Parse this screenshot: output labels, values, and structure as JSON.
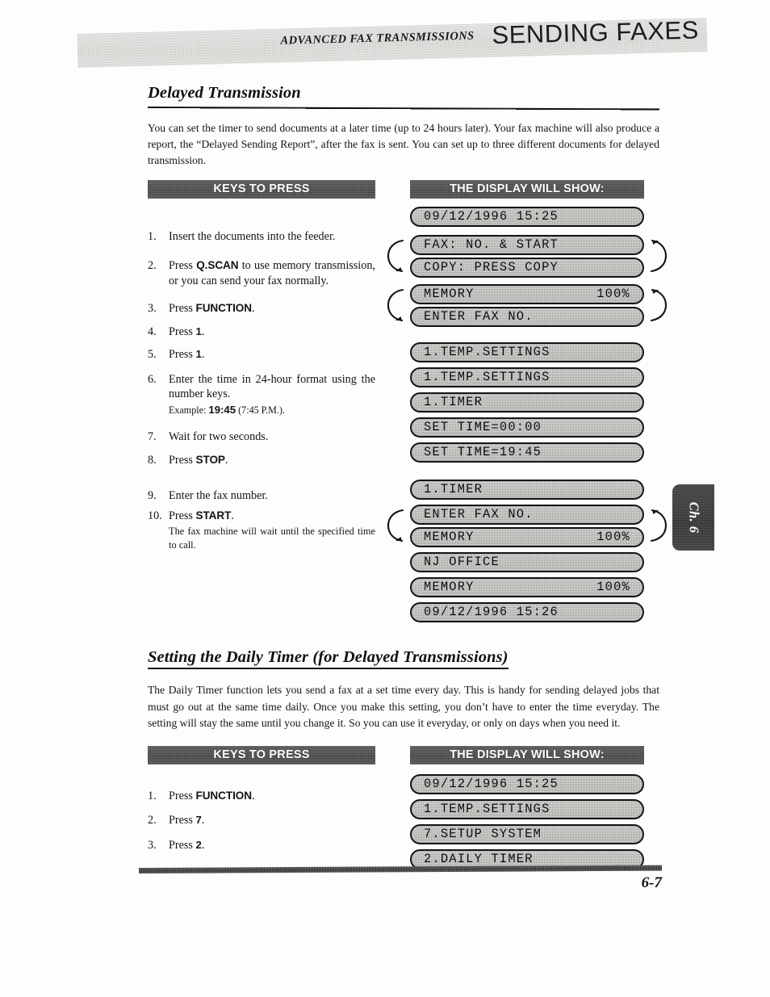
{
  "header": {
    "left_title": "ADVANCED FAX TRANSMISSIONS",
    "right_title": "SENDING FAXES"
  },
  "side_tab": {
    "label": "Ch. 6"
  },
  "footer": {
    "page_number": "6-7"
  },
  "sections": [
    {
      "heading": "Delayed Transmission",
      "intro": "You can set the timer to send documents at a later time (up to 24 hours later). Your fax machine will also produce a report, the “Delayed Sending Report”, after the fax is sent. You can set up to three different documents for delayed transmission.",
      "keys_bar": "KEYS TO PRESS",
      "display_bar": "THE DISPLAY WILL SHOW:",
      "steps": [
        {
          "num": "1.",
          "text_before": "Insert the documents into the feeder.",
          "key": "",
          "text_after": ""
        },
        {
          "num": "2.",
          "text_before": "Press ",
          "key": "Q.SCAN",
          "text_after": " to use memory transmission, or you can send your fax normally."
        },
        {
          "num": "3.",
          "text_before": "Press ",
          "key": "FUNCTION",
          "text_after": "."
        },
        {
          "num": "4.",
          "text_before": "Press ",
          "key": "1",
          "text_after": "."
        },
        {
          "num": "5.",
          "text_before": "Press ",
          "key": "1",
          "text_after": "."
        },
        {
          "num": "6.",
          "text_before": "Enter the time in 24-hour format using the number keys.",
          "key": "",
          "text_after": "",
          "note_label": "Example: ",
          "note_key": "19:45",
          "note_after": " (7:45 P.M.)."
        },
        {
          "num": "7.",
          "text_before": "Wait for two seconds.",
          "key": "",
          "text_after": ""
        },
        {
          "num": "8.",
          "text_before": "Press ",
          "key": "STOP",
          "text_after": "."
        },
        {
          "num": "9.",
          "text_before": "Enter the fax number.",
          "key": "",
          "text_after": ""
        },
        {
          "num": "10.",
          "text_before": "Press ",
          "key": "START",
          "text_after": ".",
          "sub": "The fax machine will wait until the specified time to call."
        }
      ],
      "displays": [
        {
          "left": "09/12/1996 15:25",
          "right": "",
          "paired": false
        },
        {
          "left": "FAX: NO. & START",
          "right": "",
          "paired": true,
          "pair_start": true
        },
        {
          "left": "COPY: PRESS COPY",
          "right": "",
          "paired": true,
          "pair_end": true
        },
        {
          "left": "MEMORY",
          "right": "100%",
          "paired": true,
          "pair_start": true
        },
        {
          "left": "ENTER FAX NO.",
          "right": "",
          "paired": true,
          "pair_end": true
        },
        {
          "left": "1.TEMP.SETTINGS",
          "right": "",
          "paired": false
        },
        {
          "left": "1.TEMP.SETTINGS",
          "right": "",
          "paired": false
        },
        {
          "left": "1.TIMER",
          "right": "",
          "paired": false
        },
        {
          "left": "SET TIME=00:00",
          "right": "",
          "paired": false
        },
        {
          "left": "SET TIME=19:45",
          "right": "",
          "paired": false
        },
        {
          "left": "1.TIMER",
          "right": "",
          "paired": false
        },
        {
          "left": "ENTER FAX NO.",
          "right": "",
          "paired": true,
          "pair_start": true
        },
        {
          "left": "MEMORY",
          "right": "100%",
          "paired": true,
          "pair_end": true
        },
        {
          "left": "NJ OFFICE",
          "right": "",
          "paired": false
        },
        {
          "left": "MEMORY",
          "right": "100%",
          "paired": false
        },
        {
          "left": "09/12/1996 15:26",
          "right": "",
          "paired": false
        }
      ]
    },
    {
      "heading": "Setting the Daily Timer (for Delayed Transmissions)",
      "intro": "The Daily Timer function lets you send a fax at a set time every day.  This is handy for sending delayed jobs that must go out at the same time daily.  Once you make this setting, you don’t have to enter the time everyday.  The setting will stay the same until you change it.  So you can use it everyday, or only on days when you need it.",
      "keys_bar": "KEYS TO PRESS",
      "display_bar": "THE DISPLAY WILL SHOW:",
      "steps": [
        {
          "num": "1.",
          "text_before": "Press ",
          "key": "FUNCTION",
          "text_after": "."
        },
        {
          "num": "2.",
          "text_before": "Press ",
          "key": "7",
          "text_after": "."
        },
        {
          "num": "3.",
          "text_before": "Press ",
          "key": "2",
          "text_after": "."
        }
      ],
      "displays": [
        {
          "left": "09/12/1996 15:25",
          "right": "",
          "paired": false
        },
        {
          "left": "1.TEMP.SETTINGS",
          "right": "",
          "paired": false
        },
        {
          "left": "7.SETUP SYSTEM",
          "right": "",
          "paired": false
        },
        {
          "left": "2.DAILY TIMER",
          "right": "",
          "paired": false
        }
      ]
    }
  ]
}
